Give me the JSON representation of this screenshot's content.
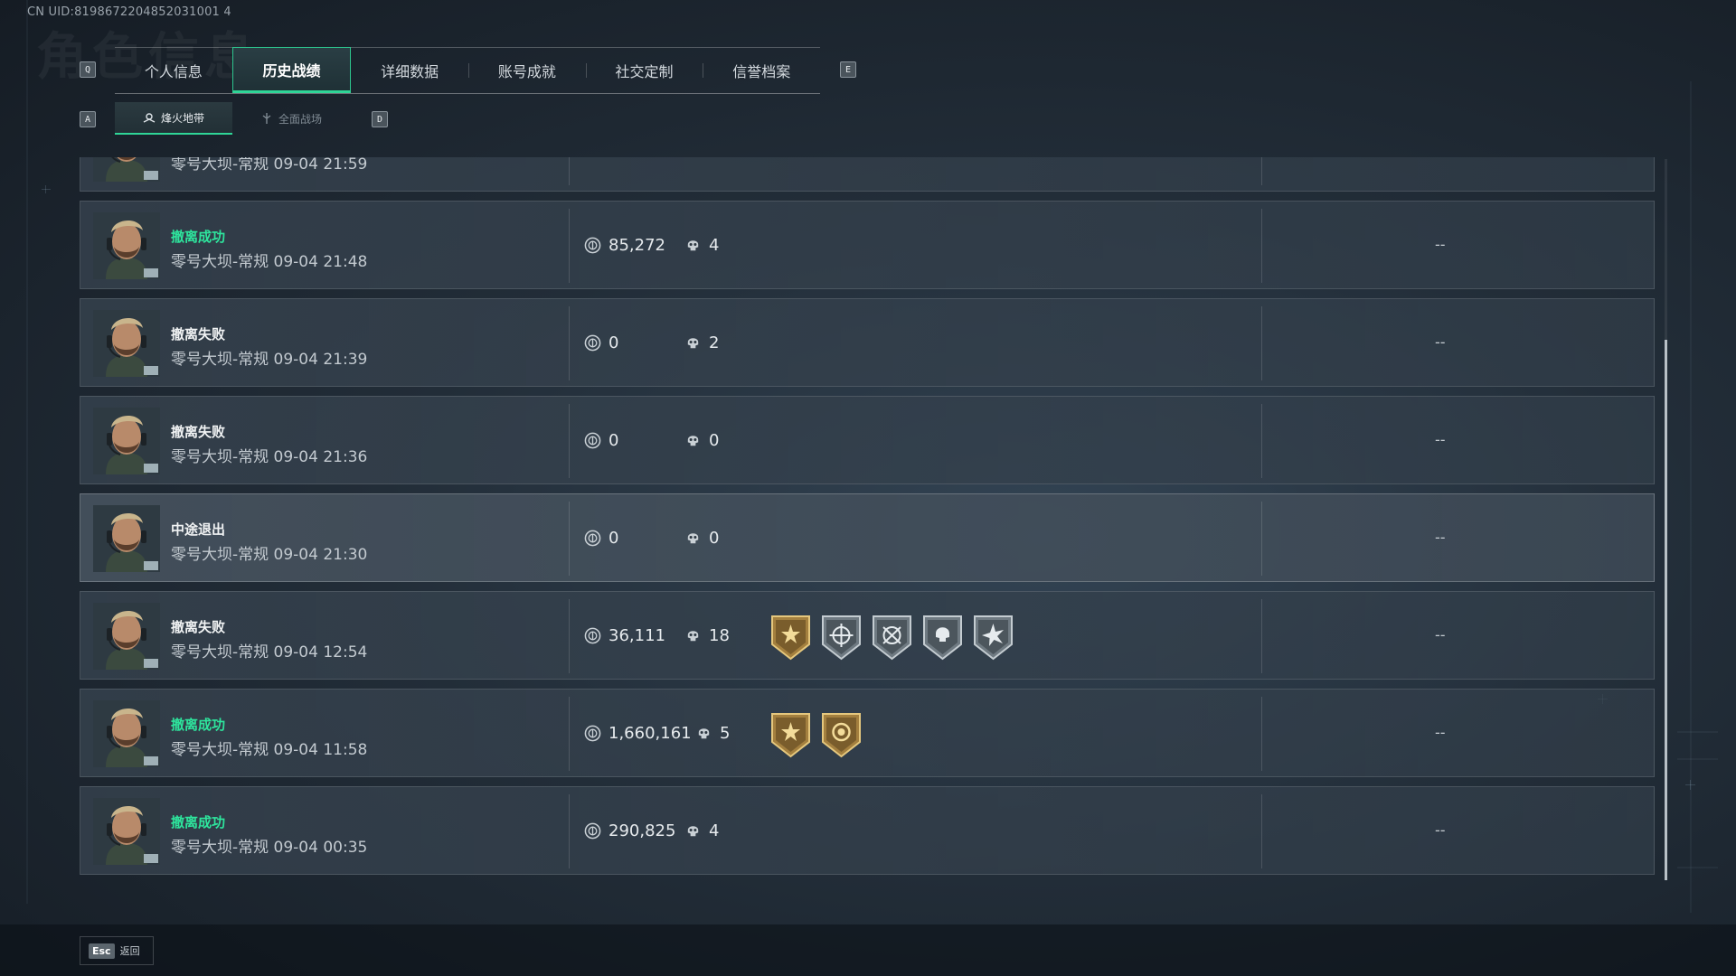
{
  "header": {
    "uid": "CN UID:8198672204852031001 4",
    "ghost_title": "角色信息"
  },
  "tabs": {
    "key_prev": "Q",
    "key_next": "E",
    "items": [
      {
        "label": "个人信息",
        "active": false
      },
      {
        "label": "历史战绩",
        "active": true
      },
      {
        "label": "详细数据",
        "active": false
      },
      {
        "label": "账号成就",
        "active": false
      },
      {
        "label": "社交定制",
        "active": false
      },
      {
        "label": "信誉档案",
        "active": false
      }
    ]
  },
  "subtabs": {
    "key_prev": "A",
    "key_next": "D",
    "items": [
      {
        "label": "烽火地带",
        "active": true
      },
      {
        "label": "全面战场",
        "active": false
      }
    ]
  },
  "records": [
    {
      "status": "",
      "map_time": "零号大坝-常规 09-04 21:59",
      "money": "",
      "kills": "",
      "badges": [],
      "extra": ""
    },
    {
      "status": "撤离成功",
      "status_type": "ok",
      "map_time": "零号大坝-常规 09-04 21:48",
      "money": "85,272",
      "kills": "4",
      "badges": [],
      "extra": "--"
    },
    {
      "status": "撤离失败",
      "status_type": "fail",
      "map_time": "零号大坝-常规 09-04 21:39",
      "money": "0",
      "kills": "2",
      "badges": [],
      "extra": "--"
    },
    {
      "status": "撤离失败",
      "status_type": "fail",
      "map_time": "零号大坝-常规 09-04 21:36",
      "money": "0",
      "kills": "0",
      "badges": [],
      "extra": "--"
    },
    {
      "status": "中途退出",
      "status_type": "fail",
      "map_time": "零号大坝-常规 09-04 21:30",
      "money": "0",
      "kills": "0",
      "badges": [],
      "extra": "--",
      "highlight": true
    },
    {
      "status": "撤离失败",
      "status_type": "fail",
      "map_time": "零号大坝-常规 09-04 12:54",
      "money": "36,111",
      "kills": "18",
      "badges": [
        "gold-star-badge",
        "silver-crosshair-badge",
        "silver-crosshair-badge",
        "silver-skull-badge",
        "silver-burst-badge"
      ],
      "extra": "--"
    },
    {
      "status": "撤离成功",
      "status_type": "ok",
      "map_time": "零号大坝-常规 09-04 11:58",
      "money": "1,660,161",
      "kills": "5",
      "badges": [
        "gold-star-badge",
        "gold-coin-badge"
      ],
      "extra": "--"
    },
    {
      "status": "撤离成功",
      "status_type": "ok",
      "map_time": "零号大坝-常规 09-04 00:35",
      "money": "290,825",
      "kills": "4",
      "badges": [],
      "extra": "--"
    }
  ],
  "footer": {
    "esc_key": "Esc",
    "back_label": "返回"
  },
  "colors": {
    "accent": "#2fd597",
    "success": "#2ee59d"
  }
}
